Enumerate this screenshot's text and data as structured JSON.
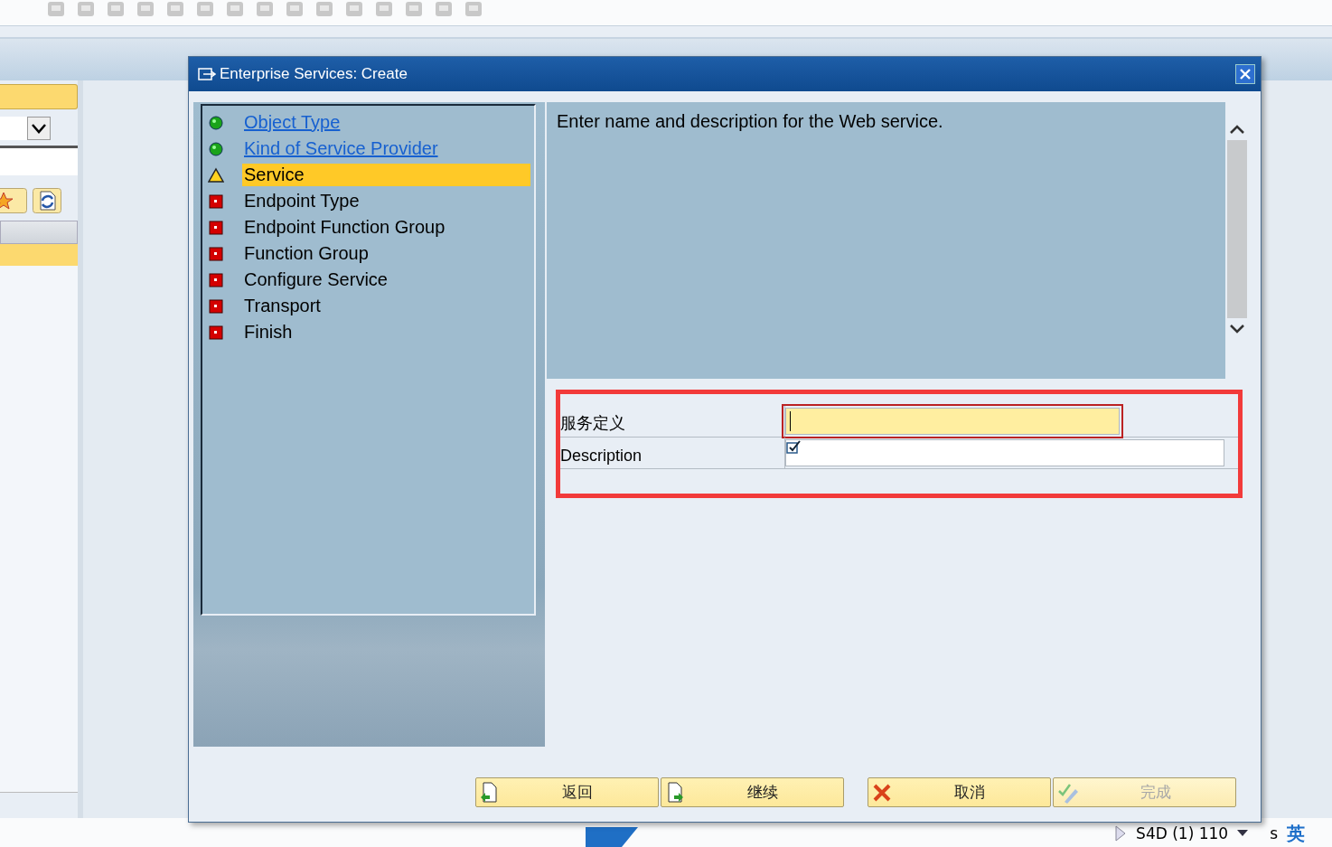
{
  "dialog": {
    "title": "Enterprise Services: Create"
  },
  "steps": [
    {
      "label": "Object Type",
      "kind": "ok",
      "link": true,
      "selected": false
    },
    {
      "label": "Kind of Service Provider",
      "kind": "ok",
      "link": true,
      "selected": false
    },
    {
      "label": "Service",
      "kind": "warning",
      "link": false,
      "selected": true
    },
    {
      "label": "Endpoint Type",
      "kind": "error",
      "link": false,
      "selected": false
    },
    {
      "label": "Endpoint Function Group",
      "kind": "error",
      "link": false,
      "selected": false
    },
    {
      "label": "Function Group",
      "kind": "error",
      "link": false,
      "selected": false
    },
    {
      "label": "Configure Service",
      "kind": "error",
      "link": false,
      "selected": false
    },
    {
      "label": "Transport",
      "kind": "error",
      "link": false,
      "selected": false
    },
    {
      "label": "Finish",
      "kind": "error",
      "link": false,
      "selected": false
    }
  ],
  "info_text": "Enter name and description for the Web service.",
  "fields": [
    {
      "label": "服务定义",
      "focused": true,
      "checked": false
    },
    {
      "label": "Description",
      "focused": false,
      "checked": true
    }
  ],
  "buttons": [
    {
      "label": "返回",
      "kind": "back",
      "disabled": false
    },
    {
      "label": "继续",
      "kind": "next",
      "disabled": false
    },
    {
      "label": "取消",
      "kind": "cancel",
      "disabled": false
    },
    {
      "label": "完成",
      "kind": "finish",
      "disabled": true
    }
  ],
  "status_bar": {
    "system": "S4D (1) 110",
    "server": "s",
    "ime": "英"
  }
}
